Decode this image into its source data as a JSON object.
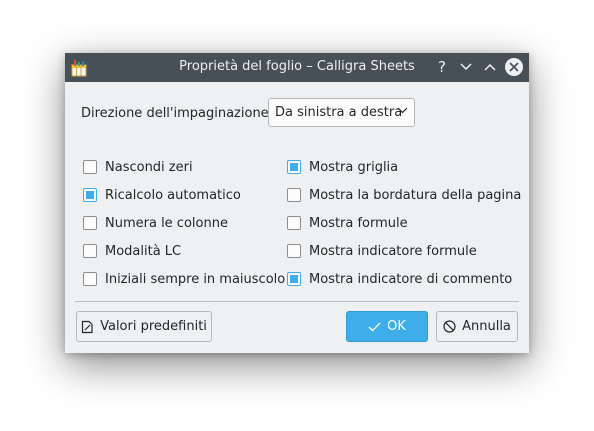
{
  "window": {
    "title": "Proprietà del foglio – Calligra Sheets"
  },
  "titlebar": {
    "help_label": "?"
  },
  "direction": {
    "label": "Direzione dell'impaginazione:",
    "selected": "Da sinistra a destra"
  },
  "options_left": [
    {
      "label": "Nascondi zeri",
      "checked": false
    },
    {
      "label": "Ricalcolo automatico",
      "checked": true
    },
    {
      "label": "Numera le colonne",
      "checked": false
    },
    {
      "label": "Modalità LC",
      "checked": false
    },
    {
      "label": "Iniziali sempre in maiuscolo",
      "checked": false
    }
  ],
  "options_right": [
    {
      "label": "Mostra griglia",
      "checked": true
    },
    {
      "label": "Mostra la bordatura della pagina",
      "checked": false
    },
    {
      "label": "Mostra formule",
      "checked": false
    },
    {
      "label": "Mostra indicatore formule",
      "checked": false
    },
    {
      "label": "Mostra indicatore di commento",
      "checked": true
    }
  ],
  "buttons": {
    "defaults_label": "Valori predefiniti",
    "ok_label": "OK",
    "cancel_label": "Annulla"
  },
  "colors": {
    "accent": "#3daee9",
    "titlebar": "#475057",
    "background": "#eff0f1"
  }
}
